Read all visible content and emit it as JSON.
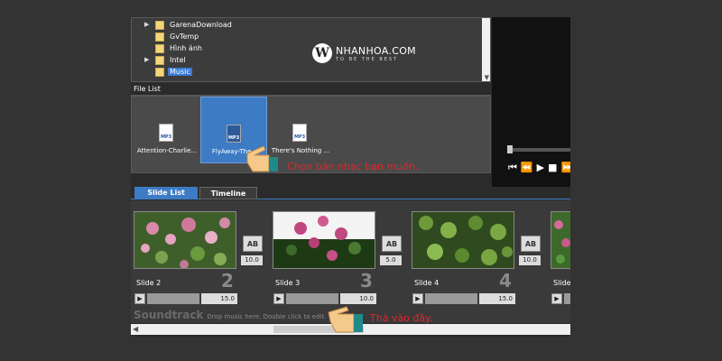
{
  "folder_tree": {
    "items": [
      {
        "label": "GarenaDownload",
        "expandable": true
      },
      {
        "label": "GvTemp",
        "expandable": false
      },
      {
        "label": "Hình ảnh",
        "expandable": false
      },
      {
        "label": "Intel",
        "expandable": true
      },
      {
        "label": "Music",
        "expandable": false,
        "selected": true
      }
    ]
  },
  "watermark": {
    "logo_letter": "W",
    "name": "NHANHOA.COM",
    "tagline": "TO BE THE BEST"
  },
  "file_list": {
    "title": "File List",
    "files": [
      {
        "name": "Attention-Charlie...",
        "type": "MP3",
        "selected": false
      },
      {
        "name": "FlyAway-The...",
        "type": "MP3",
        "selected": true
      },
      {
        "name": "There's Nothing ...",
        "type": "MP3",
        "selected": false
      }
    ]
  },
  "preview_controls": [
    "⏮",
    "⏪",
    "▶",
    "■",
    "⏩"
  ],
  "tabs": {
    "slide_list": "Slide List",
    "timeline": "Timeline"
  },
  "slides": [
    {
      "label": "Slide 2",
      "number": "2",
      "duration": "15.0",
      "transition_icon": "AB",
      "transition_duration": "10.0"
    },
    {
      "label": "Slide 3",
      "number": "3",
      "duration": "10.0",
      "transition_icon": "AB",
      "transition_duration": "5.0"
    },
    {
      "label": "Slide 4",
      "number": "4",
      "duration": "15.0",
      "transition_icon": "AB",
      "transition_duration": "10.0"
    },
    {
      "label": "Slide",
      "number": "",
      "duration": "",
      "transition_icon": "",
      "transition_duration": ""
    }
  ],
  "soundtrack": {
    "label": "Soundtrack",
    "hint": "Drop music here.  Double click to edit."
  },
  "annotations": {
    "choose_music": "Chọn bản nhạc bạn muốn.",
    "drop_here": "Thả vào đây."
  },
  "colors": {
    "accent": "#3d7bc4",
    "annotation_red": "#e0282c",
    "hand_skin": "#f5c98a",
    "hand_cuff": "#1f8a8a"
  }
}
